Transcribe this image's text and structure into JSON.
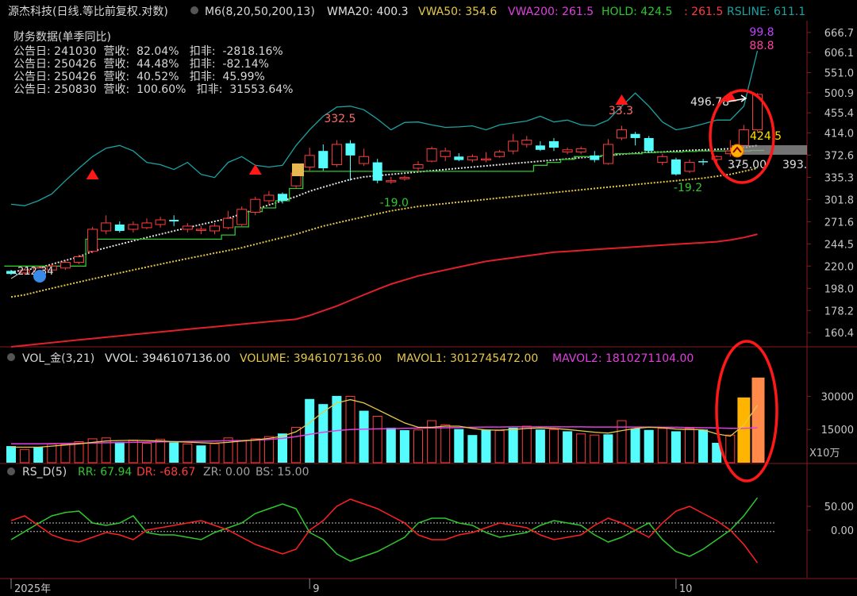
{
  "colors": {
    "up": "#ff3c3c",
    "down": "#54fcfc",
    "white": "#e0e0e0",
    "yellow": "#e6c84a",
    "magenta": "#e040e0",
    "green": "#2ec82e",
    "teal": "#1aa3a3",
    "red_line": "#e0202a",
    "annot_red": "#ff1818",
    "axis": "#8a1a1a",
    "grid": "#6e1414"
  },
  "header": {
    "stock_name": "源杰科技(日线.等比前复权.对数)",
    "m6": "M6(8,20,50,200,13)",
    "wma20": "WMA20: 400.3",
    "vwa50": "VWA50: 354.6",
    "vwa200": "VWA200: 261.5",
    "hold": "HOLD: 424.5",
    "hold2": ": 261.5",
    "rsline": "RSLINE: 611.1"
  },
  "finance": {
    "title": "财务数据(单季同比)",
    "rows": [
      "公告日: 241030  营收:  82.04%   扣非:  -2818.16%",
      "公告日: 250426  营收:  44.48%   扣非:  -82.14%",
      "公告日: 250426  营收:  40.52%   扣非:  45.99%",
      "公告日: 250830  营收:  100.60%   扣非:  31553.64%"
    ]
  },
  "vol_header": {
    "name": "VOL_金(3,21)",
    "vvol": "VVOL: 3946107136.00",
    "volume": "VOLUME: 3946107136.00",
    "mavol1": "MAVOL1: 3012745472.00",
    "mavol2": "MAVOL2: 1810271104.00"
  },
  "rs_header": {
    "name": "RS_D(5)",
    "rr": "RR: 67.94",
    "dr": "DR: -68.67",
    "zr": "ZR: 0.00",
    "bs": "BS: 15.00"
  },
  "vol_unit": "X10万",
  "x_labels": [
    {
      "label": "2025年",
      "index": 0
    },
    {
      "label": "9",
      "index": 22
    },
    {
      "label": "10",
      "index": 49
    }
  ],
  "chart_data": [
    {
      "type": "candlestick",
      "scale": "log",
      "ylim": [
        150,
        700
      ],
      "y_ticks": [
        666.7,
        606.1,
        551.0,
        500.9,
        455.4,
        414.0,
        372.6,
        335.3,
        301.8,
        271.6,
        244.5,
        220.0,
        198.0,
        178.2,
        160.4
      ],
      "candles": [
        [
          212,
          215,
          211,
          216,
          "d"
        ],
        [
          213,
          216,
          211,
          218,
          "u"
        ],
        [
          214,
          218,
          213,
          220,
          "u"
        ],
        [
          216,
          220,
          214,
          222,
          "u"
        ],
        [
          218,
          224,
          216,
          226,
          "u"
        ],
        [
          224,
          230,
          222,
          232,
          "u"
        ],
        [
          236,
          262,
          234,
          265,
          "u"
        ],
        [
          260,
          270,
          256,
          280,
          "u"
        ],
        [
          268,
          260,
          258,
          272,
          "d"
        ],
        [
          262,
          268,
          258,
          272,
          "u"
        ],
        [
          264,
          270,
          262,
          276,
          "u"
        ],
        [
          268,
          274,
          264,
          278,
          "u"
        ],
        [
          274,
          272,
          266,
          280,
          "d"
        ],
        [
          262,
          266,
          258,
          270,
          "u"
        ],
        [
          262,
          262,
          256,
          266,
          "u"
        ],
        [
          260,
          266,
          256,
          270,
          "u"
        ],
        [
          264,
          276,
          262,
          286,
          "u"
        ],
        [
          268,
          288,
          266,
          292,
          "u"
        ],
        [
          284,
          302,
          280,
          306,
          "u"
        ],
        [
          300,
          308,
          294,
          314,
          "u"
        ],
        [
          310,
          300,
          296,
          312,
          "d"
        ],
        [
          322,
          342,
          318,
          350,
          "u"
        ],
        [
          352,
          372,
          346,
          386,
          "u"
        ],
        [
          380,
          350,
          346,
          392,
          "d"
        ],
        [
          356,
          392,
          352,
          400,
          "u"
        ],
        [
          394,
          372,
          330,
          400,
          "d"
        ],
        [
          370,
          358,
          354,
          384,
          "u"
        ],
        [
          360,
          330,
          326,
          366,
          "d"
        ],
        [
          330,
          330,
          325,
          336,
          "u"
        ],
        [
          333,
          335,
          330,
          338,
          "u"
        ],
        [
          350,
          356,
          345,
          362,
          "u"
        ],
        [
          362,
          384,
          360,
          388,
          "u"
        ],
        [
          370,
          380,
          362,
          386,
          "u"
        ],
        [
          370,
          364,
          362,
          376,
          "d"
        ],
        [
          364,
          370,
          360,
          374,
          "u"
        ],
        [
          364,
          366,
          360,
          378,
          "u"
        ],
        [
          370,
          378,
          368,
          382,
          "u"
        ],
        [
          380,
          398,
          374,
          412,
          "u"
        ],
        [
          392,
          400,
          386,
          408,
          "u"
        ],
        [
          390,
          382,
          380,
          398,
          "d"
        ],
        [
          398,
          386,
          380,
          404,
          "d"
        ],
        [
          378,
          382,
          374,
          386,
          "u"
        ],
        [
          378,
          384,
          374,
          388,
          "u"
        ],
        [
          372,
          364,
          360,
          380,
          "d"
        ],
        [
          358,
          392,
          356,
          402,
          "u"
        ],
        [
          404,
          420,
          400,
          428,
          "u"
        ],
        [
          412,
          404,
          390,
          416,
          "d"
        ],
        [
          404,
          380,
          376,
          408,
          "d"
        ],
        [
          370,
          360,
          355,
          375,
          "u"
        ],
        [
          365,
          340,
          338,
          368,
          "d"
        ],
        [
          345,
          360,
          342,
          365,
          "u"
        ],
        [
          360,
          362,
          355,
          366,
          "d"
        ],
        [
          365,
          370,
          360,
          372,
          "u"
        ],
        [
          375,
          380,
          370,
          400,
          "u"
        ],
        [
          390,
          420,
          385,
          430,
          "u"
        ],
        [
          420,
          497,
          415,
          500,
          "u"
        ]
      ],
      "lines": {
        "white_ma": [
          214,
          216,
          218,
          222,
          226,
          230,
          236,
          240,
          244,
          248,
          252,
          256,
          260,
          264,
          268,
          272,
          276,
          282,
          288,
          294,
          300,
          306,
          314,
          320,
          326,
          332,
          336,
          338,
          340,
          342,
          344,
          346,
          348,
          350,
          352,
          354,
          356,
          358,
          360,
          362,
          364,
          366,
          368,
          370,
          372,
          374,
          376,
          378,
          378,
          380,
          381,
          382,
          383,
          384,
          386,
          390
        ],
        "yellow_ma": [
          190,
          192,
          195,
          198,
          201,
          204,
          207,
          210,
          213,
          216,
          219,
          222,
          225,
          228,
          231,
          234,
          237,
          240,
          244,
          248,
          252,
          256,
          261,
          266,
          270,
          274,
          278,
          282,
          286,
          289,
          292,
          294,
          296,
          298,
          300,
          302,
          304,
          306,
          308,
          310,
          312,
          314,
          316,
          318,
          320,
          322,
          324,
          326,
          328,
          330,
          332,
          334,
          337,
          340,
          345,
          350
        ],
        "red_ma": [
          150,
          151,
          152,
          153,
          154,
          155,
          156,
          157,
          158,
          159,
          160,
          161,
          162,
          163,
          164,
          165,
          166,
          167,
          168,
          169,
          170,
          171,
          174,
          178,
          182,
          187,
          192,
          197,
          202,
          206,
          210,
          213,
          216,
          219,
          222,
          225,
          227,
          229,
          231,
          233,
          235,
          236,
          237,
          238,
          239,
          240,
          241,
          242,
          243,
          244,
          245,
          246,
          247,
          249,
          252,
          256
        ],
        "teal_band": [
          295,
          293,
          300,
          310,
          330,
          350,
          370,
          385,
          390,
          380,
          360,
          356,
          348,
          360,
          340,
          335,
          360,
          370,
          355,
          352,
          355,
          390,
          420,
          448,
          468,
          470,
          462,
          442,
          420,
          435,
          436,
          430,
          425,
          426,
          428,
          420,
          430,
          434,
          438,
          448,
          436,
          440,
          430,
          428,
          440,
          470,
          500,
          470,
          436,
          420,
          425,
          432,
          440,
          440,
          470,
          611
        ],
        "green_hold": [
          220,
          220,
          220,
          220,
          220,
          220,
          250,
          250,
          250,
          250,
          250,
          250,
          250,
          250,
          250,
          250,
          255,
          265,
          285,
          290,
          300,
          318,
          345,
          345,
          345,
          345,
          345,
          345,
          345,
          345,
          345,
          345,
          345,
          345,
          345,
          345,
          345,
          345,
          345,
          355,
          360,
          365,
          370,
          370,
          372,
          375,
          375,
          377,
          378,
          378,
          379,
          380,
          380,
          380,
          380,
          381
        ]
      },
      "annotations": {
        "label_332": "332.5",
        "label_19_0": "-19.0",
        "label_33_3": "33.3",
        "label_19_2": "-19.2",
        "label_496": "496.78",
        "label_424": "424.5",
        "label_375": "375.00",
        "label_393": "393.",
        "label_99": "99.8",
        "label_88": "88.8",
        "label_212": "212.34"
      }
    },
    {
      "type": "bar",
      "name": "volume",
      "y_ticks": [
        30000,
        15000
      ],
      "ylim": [
        0,
        42000
      ],
      "values": [
        7500,
        6000,
        7200,
        8400,
        8200,
        9500,
        10800,
        11200,
        9400,
        10200,
        8800,
        10500,
        9200,
        8500,
        7800,
        8600,
        11200,
        9800,
        10800,
        11800,
        13200,
        16000,
        28800,
        26500,
        30200,
        30000,
        23500,
        21000,
        15800,
        14700,
        14800,
        19000,
        17100,
        15200,
        12500,
        15000,
        14500,
        15800,
        16500,
        15000,
        15000,
        14200,
        13000,
        12500,
        12800,
        19000,
        15500,
        14800,
        15500,
        14200,
        15500,
        15000,
        9000,
        12500,
        29500,
        38500
      ],
      "colors": [
        "d",
        "u",
        "d",
        "u",
        "u",
        "u",
        "u",
        "u",
        "d",
        "u",
        "u",
        "u",
        "d",
        "u",
        "d",
        "u",
        "u",
        "u",
        "u",
        "u",
        "d",
        "u",
        "d",
        "d",
        "d",
        "u",
        "d",
        "u",
        "d",
        "d",
        "u",
        "u",
        "u",
        "d",
        "d",
        "d",
        "u",
        "d",
        "u",
        "d",
        "u",
        "d",
        "u",
        "u",
        "d",
        "u",
        "d",
        "d",
        "u",
        "d",
        "u",
        "d",
        "d",
        "u",
        "y",
        "o"
      ],
      "ma1": [
        7000,
        7000,
        7000,
        7500,
        8000,
        8500,
        9200,
        9800,
        10000,
        10100,
        10000,
        9800,
        9500,
        9300,
        9000,
        8800,
        9200,
        9800,
        10300,
        11000,
        12000,
        14000,
        18000,
        23000,
        27000,
        28500,
        27000,
        24000,
        21000,
        18000,
        16000,
        16000,
        16500,
        16500,
        15500,
        14800,
        14700,
        15000,
        15500,
        15700,
        15500,
        15000,
        14400,
        13800,
        13400,
        14500,
        15500,
        16000,
        15800,
        15200,
        15000,
        14900,
        13000,
        12000,
        17000,
        26000
      ],
      "ma2": [
        8500,
        8500,
        8500,
        8600,
        8700,
        8800,
        8900,
        9000,
        9100,
        9200,
        9300,
        9400,
        9500,
        9600,
        9700,
        9800,
        9900,
        10000,
        10200,
        10500,
        11000,
        11800,
        12800,
        13800,
        14500,
        15000,
        15200,
        15300,
        15400,
        15500,
        15600,
        15700,
        15800,
        15900,
        16000,
        16100,
        16100,
        16200,
        16200,
        16200,
        16200,
        16200,
        16200,
        16100,
        16100,
        16100,
        16100,
        16100,
        16000,
        16000,
        15900,
        15800,
        15700,
        15500,
        15500,
        15800
      ]
    },
    {
      "type": "line",
      "name": "RS_D",
      "y_ticks": [
        50.0,
        0.0
      ],
      "ylim": [
        -100,
        100
      ],
      "hlines": [
        15,
        -3
      ],
      "series": [
        {
          "key": "rr",
          "values": [
            -20,
            -3,
            14,
            30,
            37,
            40,
            15,
            10,
            15,
            30,
            -5,
            -10,
            -10,
            -15,
            -20,
            -5,
            5,
            15,
            35,
            45,
            55,
            45,
            -5,
            -20,
            -50,
            -65,
            -55,
            -45,
            -30,
            -15,
            15,
            25,
            25,
            15,
            10,
            -5,
            -15,
            -10,
            -5,
            10,
            20,
            15,
            10,
            -10,
            -25,
            -15,
            0,
            15,
            -20,
            -45,
            -55,
            -40,
            -20,
            0,
            30,
            67.94
          ]
        },
        {
          "key": "dr",
          "values": [
            20,
            30,
            10,
            -10,
            -20,
            -25,
            -15,
            -5,
            -10,
            -20,
            0,
            5,
            10,
            15,
            20,
            10,
            0,
            -15,
            -30,
            -40,
            -50,
            -40,
            0,
            20,
            50,
            65,
            55,
            45,
            30,
            15,
            -10,
            -20,
            -20,
            -10,
            -5,
            5,
            15,
            10,
            5,
            -10,
            -20,
            -15,
            -10,
            10,
            25,
            15,
            0,
            -15,
            15,
            40,
            50,
            35,
            20,
            0,
            -30,
            -68.67
          ]
        }
      ]
    }
  ]
}
